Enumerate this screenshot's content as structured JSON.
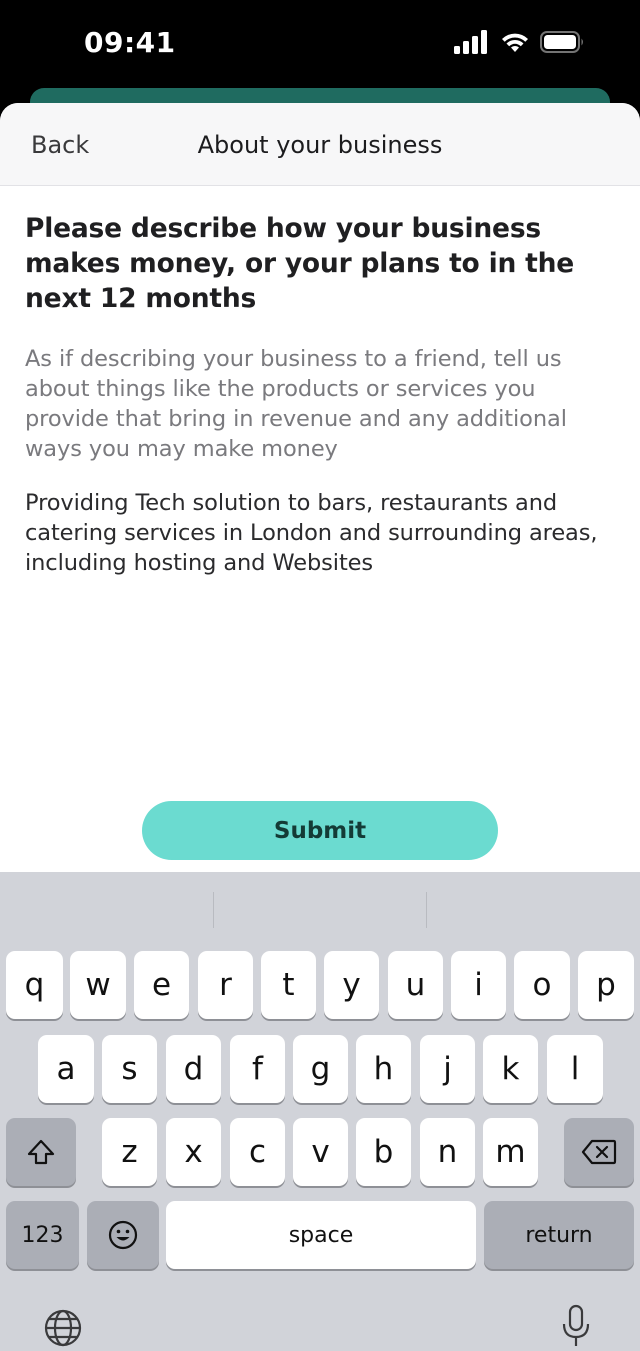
{
  "status_bar": {
    "time": "09:41"
  },
  "nav": {
    "back": "Back",
    "title": "About your business"
  },
  "question": "Please describe how your business makes money, or your plans to in the next 12 months",
  "helper": "As if describing your business to a friend, tell us about things like the products or services you provide that bring in revenue and any additional ways you may make money",
  "answer": "Providing Tech solution to bars, restaurants and catering services in London and surrounding areas, including hosting and Websites",
  "submit": "Submit",
  "keyboard": {
    "row1": [
      "q",
      "w",
      "e",
      "r",
      "t",
      "y",
      "u",
      "i",
      "o",
      "p"
    ],
    "row2": [
      "a",
      "s",
      "d",
      "f",
      "g",
      "h",
      "j",
      "k",
      "l"
    ],
    "row3": [
      "z",
      "x",
      "c",
      "v",
      "b",
      "n",
      "m"
    ],
    "numbers": "123",
    "space": "space",
    "return": "return"
  },
  "icons": [
    "signal-icon",
    "wifi-icon",
    "battery-icon",
    "shift-icon",
    "backspace-icon",
    "emoji-icon",
    "globe-icon",
    "microphone-icon"
  ]
}
